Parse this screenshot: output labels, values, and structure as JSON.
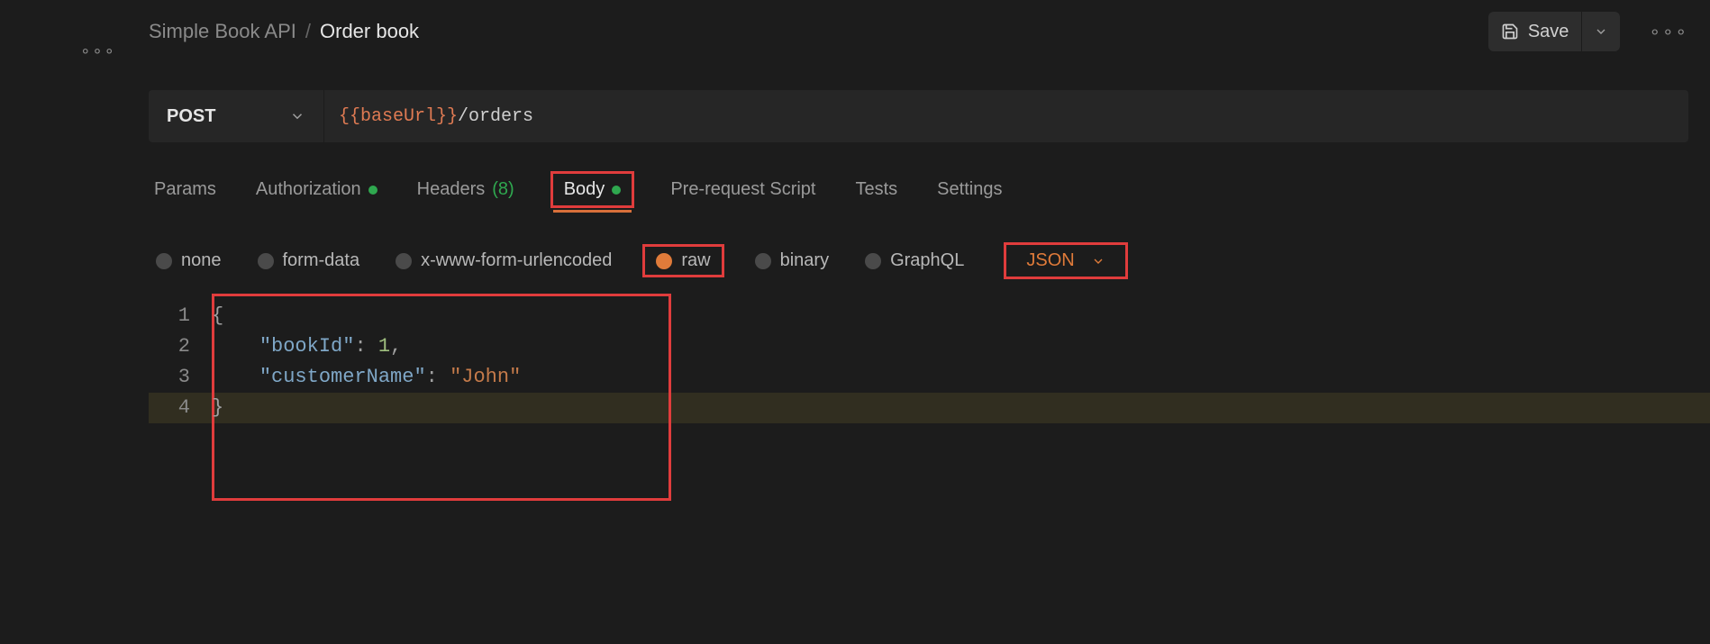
{
  "breadcrumb": {
    "collection": "Simple Book API",
    "separator": "/",
    "request": "Order book"
  },
  "actions": {
    "save_label": "Save"
  },
  "method": {
    "value": "POST",
    "url_variable": "{{baseUrl}}",
    "url_path": "/orders"
  },
  "tabs": {
    "params": "Params",
    "authorization": "Authorization",
    "headers_label": "Headers",
    "headers_count": "(8)",
    "body": "Body",
    "pre_request": "Pre-request Script",
    "tests": "Tests",
    "settings": "Settings"
  },
  "body_types": {
    "none": "none",
    "form_data": "form-data",
    "urlencoded": "x-www-form-urlencoded",
    "raw": "raw",
    "binary": "binary",
    "graphql": "GraphQL",
    "format": "JSON"
  },
  "editor": {
    "lines": [
      "1",
      "2",
      "3",
      "4"
    ],
    "code": {
      "open_brace": "{",
      "l2_key": "\"bookId\"",
      "l2_colon": ": ",
      "l2_val": "1",
      "l2_comma": ",",
      "l3_key": "\"customerName\"",
      "l3_colon": ": ",
      "l3_val": "\"John\"",
      "close_brace": "}"
    }
  }
}
